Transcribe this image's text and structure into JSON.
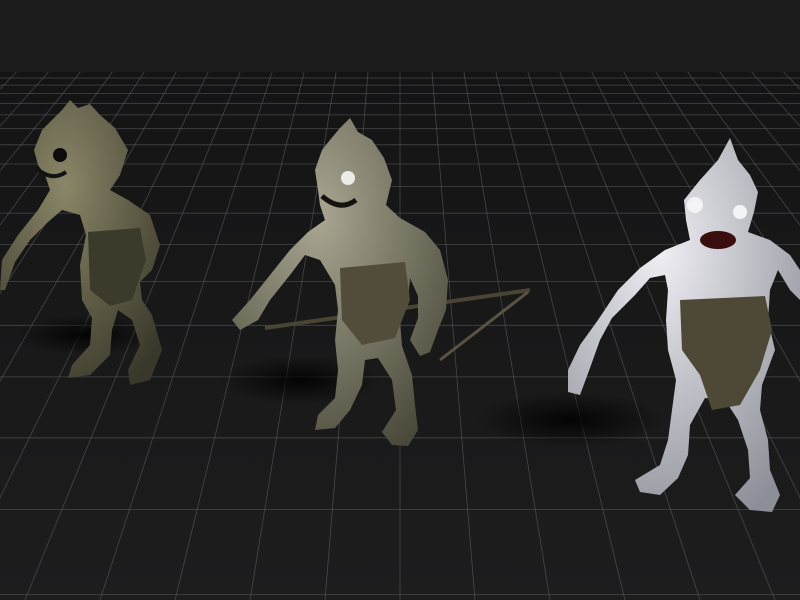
{
  "scene": {
    "sky_color": "#1c1c1d",
    "floor_color": "#1a1a1b",
    "grid_line_color": "#5a5a5c",
    "shadow_color": "#050505"
  },
  "creatures": [
    {
      "name": "fish-creature-dark",
      "variant": "dark olive",
      "skin_color": "#6d6a52",
      "shade_color": "#3e3c2d",
      "eye": "dark",
      "holding_spear": false
    },
    {
      "name": "fish-creature-olive",
      "variant": "olive with white eyes",
      "skin_color": "#8e8c78",
      "shade_color": "#4d4b3d",
      "eye": "white",
      "holding_spear": true
    },
    {
      "name": "fish-creature-pale",
      "variant": "pale albino",
      "skin_color": "#cfcfd6",
      "shade_color": "#8c8c96",
      "eye": "white",
      "holding_spear": false
    }
  ]
}
